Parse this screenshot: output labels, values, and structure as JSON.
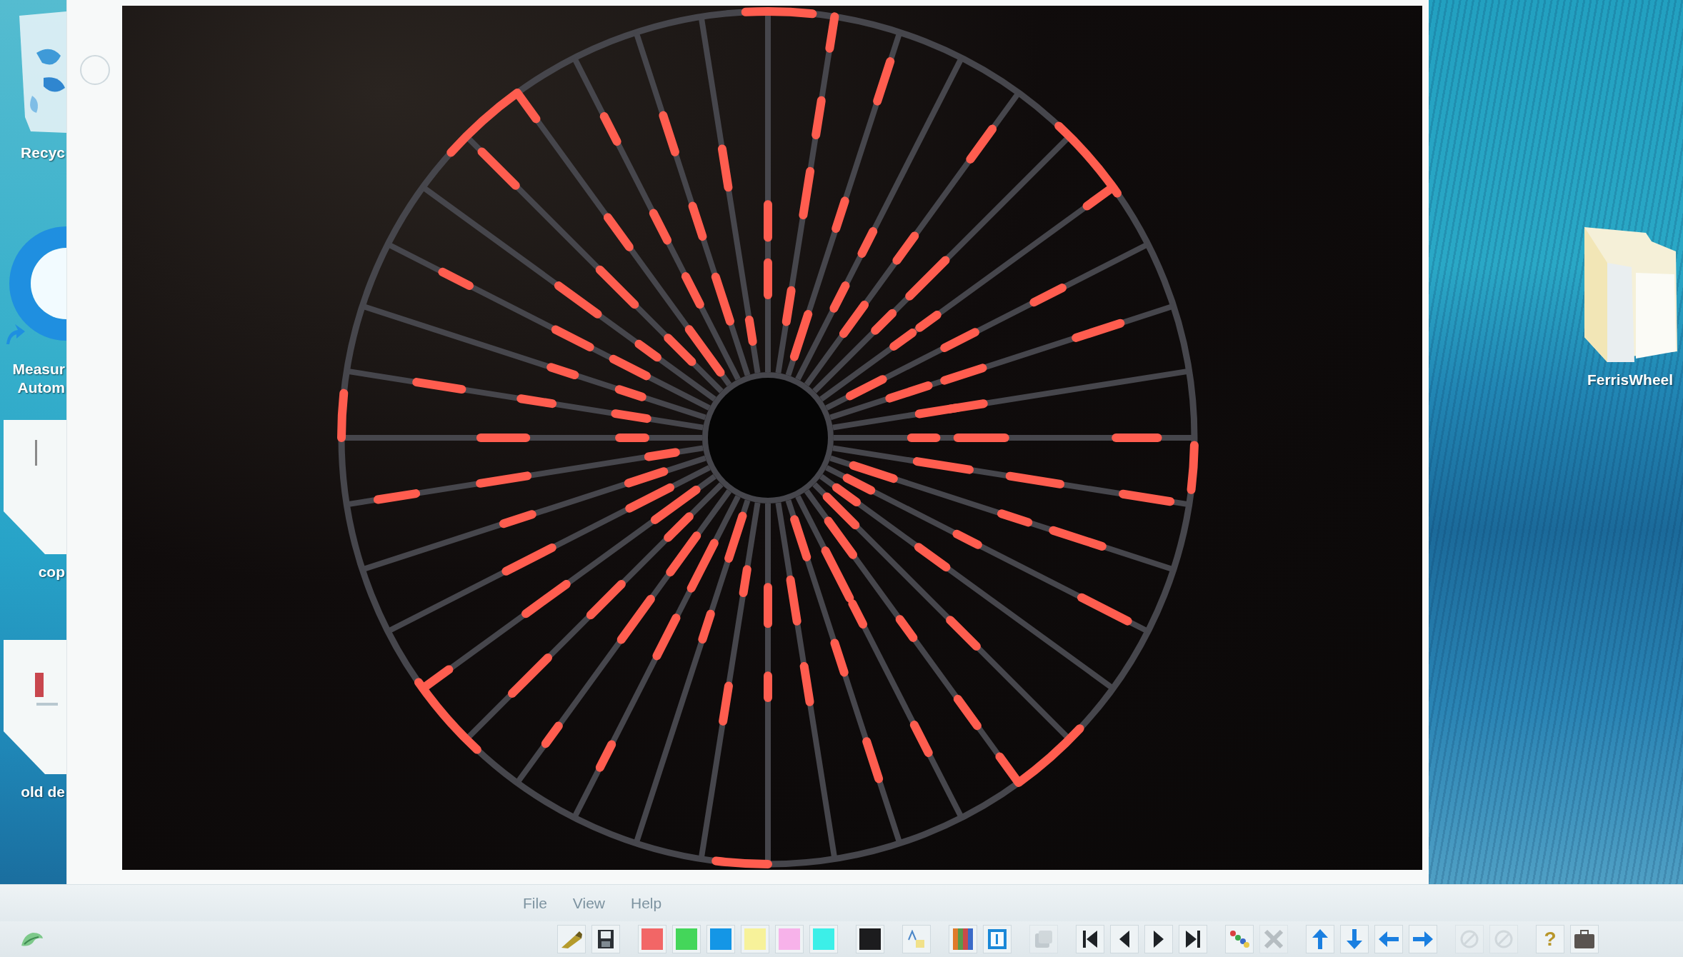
{
  "desktop": {
    "left_icons": [
      {
        "kind": "recycle",
        "label": "Recyc"
      },
      {
        "kind": "globe",
        "label": "Measur Autom"
      },
      {
        "kind": "page",
        "label": "cop"
      },
      {
        "kind": "markedpage",
        "label": "old de"
      }
    ],
    "right_icons": [
      {
        "kind": "folder",
        "label": "FerrisWheel"
      }
    ]
  },
  "menu": [
    {
      "label": "File"
    },
    {
      "label": "View"
    },
    {
      "label": "Help"
    }
  ],
  "toolbar": {
    "groups": [
      [
        {
          "kind": "pencil",
          "disabled": false
        },
        {
          "kind": "save",
          "disabled": false
        }
      ],
      [
        {
          "kind": "swatch",
          "color": "#f26666",
          "disabled": false
        },
        {
          "kind": "swatch",
          "color": "#44d65a",
          "disabled": false
        },
        {
          "kind": "swatch",
          "color": "#1496e6",
          "disabled": false
        },
        {
          "kind": "swatch",
          "color": "#f7f29a",
          "disabled": false
        },
        {
          "kind": "swatch",
          "color": "#f7b2ea",
          "disabled": false
        },
        {
          "kind": "swatch",
          "color": "#3cefe8",
          "disabled": false
        }
      ],
      [
        {
          "kind": "swatch",
          "color": "#1c1c1e",
          "disabled": false
        }
      ],
      [
        {
          "kind": "shapes",
          "disabled": false
        }
      ],
      [
        {
          "kind": "colorbars",
          "disabled": false
        },
        {
          "kind": "frame",
          "disabled": false
        }
      ],
      [
        {
          "kind": "stack",
          "disabled": true
        }
      ],
      [
        {
          "kind": "first",
          "disabled": false
        },
        {
          "kind": "prev",
          "disabled": false
        },
        {
          "kind": "next",
          "disabled": false
        },
        {
          "kind": "last",
          "disabled": false
        }
      ],
      [
        {
          "kind": "dots",
          "disabled": false
        },
        {
          "kind": "cross",
          "disabled": true
        }
      ],
      [
        {
          "kind": "up",
          "disabled": false
        },
        {
          "kind": "down",
          "disabled": false
        },
        {
          "kind": "left",
          "disabled": false
        },
        {
          "kind": "right",
          "disabled": false
        }
      ],
      [
        {
          "kind": "circle",
          "disabled": true
        },
        {
          "kind": "circle",
          "disabled": true
        }
      ],
      [
        {
          "kind": "help",
          "label": "?",
          "disabled": false
        },
        {
          "kind": "case",
          "disabled": false
        }
      ]
    ]
  }
}
